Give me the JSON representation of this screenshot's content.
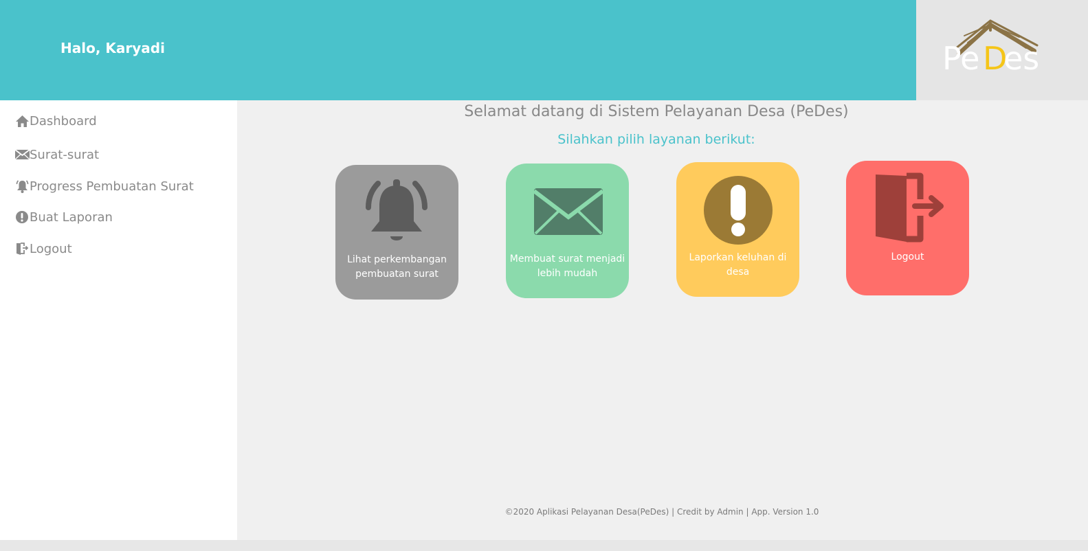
{
  "header": {
    "greeting": "Halo, Karyadi",
    "background_color": "#4ac2cb"
  },
  "logo": {
    "text_pe": "Pe",
    "text_d": "D",
    "text_es": "es",
    "accent_color": "#f5c518",
    "roof_color": "#8b7346"
  },
  "sidebar": {
    "items": [
      {
        "label": "Dashboard",
        "icon": "home-icon"
      },
      {
        "label": "Surat-surat",
        "icon": "envelope-icon"
      },
      {
        "label": "Progress Pembuatan Surat",
        "icon": "bell-icon"
      },
      {
        "label": "Buat Laporan",
        "icon": "exclamation-icon"
      },
      {
        "label": "Logout",
        "icon": "logout-icon"
      }
    ]
  },
  "main": {
    "welcome": "Selamat datang di Sistem Pelayanan Desa (PeDes)",
    "subtitle": "Silahkan pilih layanan berikut:",
    "cards": [
      {
        "label": "Lihat perkembangan pembuatan surat",
        "icon": "bell-icon",
        "color": "#9b9b9b",
        "icon_color": "#5c5c5c"
      },
      {
        "label": "Membuat surat menjadi lebih mudah",
        "icon": "envelope-icon",
        "color": "#8bdaac",
        "icon_color": "#527e69"
      },
      {
        "label": "Laporkan keluhan di desa",
        "icon": "exclamation-circle-icon",
        "color": "#ffcb5c",
        "icon_color": "#9b7a35"
      },
      {
        "label": "Logout",
        "icon": "door-exit-icon",
        "color": "#ff6e6a",
        "icon_color": "#9e403a"
      }
    ]
  },
  "footer": {
    "text": "©2020 Aplikasi Pelayanan Desa(PeDes) | Credit by Admin | App. Version 1.0"
  }
}
